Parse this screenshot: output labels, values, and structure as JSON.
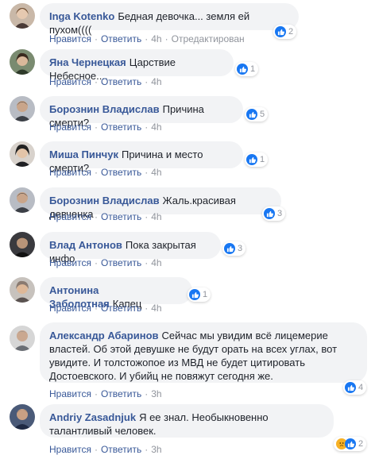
{
  "colors": {
    "link": "#385898",
    "bubble": "#f2f3f5",
    "meta": "#90949c",
    "like": "#1877f2"
  },
  "comments": [
    {
      "author": "Inga Kotenko",
      "text": "Бедная девочка... земля ей пухом((((",
      "like": "Нравится",
      "reply": "Ответить",
      "time": "4h",
      "edited": "Отредактирован",
      "reactions": "2"
    },
    {
      "author": "Яна Чернецкая",
      "text": "Царствие Небесное....",
      "like": "Нравится",
      "reply": "Ответить",
      "time": "4h",
      "reactions": "1"
    },
    {
      "author": "Борознин Владислав",
      "text": "Причина смерти?",
      "like": "Нравится",
      "reply": "Ответить",
      "time": "4h",
      "reactions": "5"
    },
    {
      "author": "Миша Пинчук",
      "text": "Причина и место смерти?",
      "like": "Нравится",
      "reply": "Ответить",
      "time": "4h",
      "reactions": "1"
    },
    {
      "author": "Борознин Владислав",
      "text": "Жаль.красивая девченка",
      "like": "Нравится",
      "reply": "Ответить",
      "time": "4h",
      "reactions": "3"
    },
    {
      "author": "Влад Антонов",
      "text": "Пока закрытая инфо",
      "like": "Нравится",
      "reply": "Ответить",
      "time": "4h",
      "reactions": "3"
    },
    {
      "author": "Антонина Заболотная",
      "text": "Капец",
      "like": "Нравится",
      "reply": "Ответить",
      "time": "4h",
      "reactions": "1"
    },
    {
      "author": "Александр Абаринов",
      "text": "Сейчас мы увидим всё лицемерие властей. Об этой девушке не будут орать на всех углах, вот увидите. И толстожопое из МВД не будет цитировать Достоевского. И убийц не повяжут сегодня же.",
      "like": "Нравится",
      "reply": "Ответить",
      "time": "3h",
      "reactions": "4"
    },
    {
      "author": "Andriy Zasadnjuk",
      "text": "Я ее знал. Необыкновенно талантливый человек.",
      "like": "Нравится",
      "reply": "Ответить",
      "time": "3h",
      "reactions": "2"
    }
  ]
}
